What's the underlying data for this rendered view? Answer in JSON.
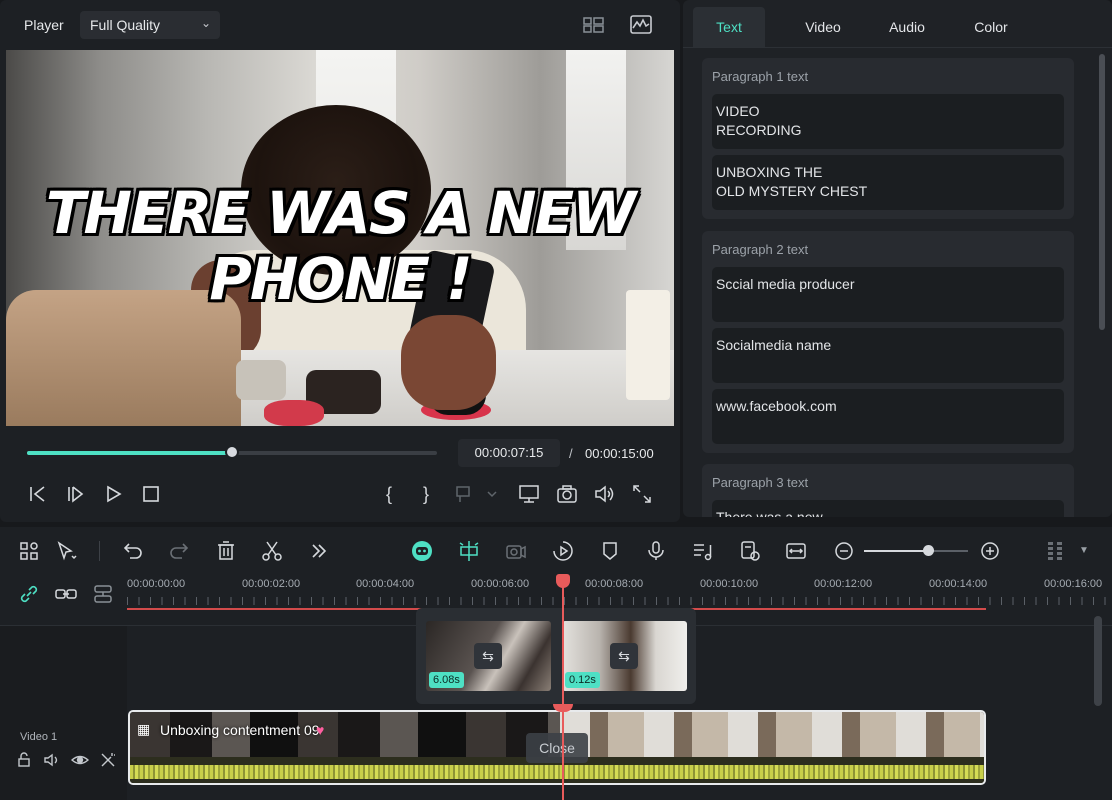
{
  "player": {
    "label": "Player",
    "quality": "Full Quality",
    "overlay_line1": "THERE WAS A NEW",
    "overlay_line2": "PHONE !",
    "current_time": "00:00:07:15",
    "time_separator": "/",
    "total_time": "00:00:15:00",
    "progress_fraction": 0.5,
    "icons": [
      "grid-view-icon",
      "waveform-icon",
      "step-back-icon",
      "step-forward-icon",
      "play-icon",
      "stop-icon",
      "mark-in-icon",
      "mark-out-icon",
      "insert-icon",
      "display-icon",
      "snapshot-icon",
      "volume-icon",
      "fullscreen-icon"
    ]
  },
  "props": {
    "tabs": [
      "Text",
      "Video",
      "Audio",
      "Color"
    ],
    "active_tab": "Text",
    "groups": [
      {
        "title": "Paragraph 1 text",
        "fields": [
          "VIDEO\nRECORDING",
          "UNBOXING THE\nOLD MYSTERY CHEST"
        ]
      },
      {
        "title": "Paragraph 2 text",
        "fields": [
          "Sccial media producer",
          "Socialmedia name",
          "www.facebook.com"
        ]
      },
      {
        "title": "Paragraph 3 text",
        "fields": [
          "There was a new"
        ]
      }
    ]
  },
  "timeline": {
    "toolbar_icons": [
      "layout-icon",
      "select-icon",
      "undo-icon",
      "redo-icon",
      "delete-icon",
      "cut-icon",
      "more-icon",
      "ai-mate-icon",
      "auto-split-icon",
      "ai-camera-icon",
      "speed-icon",
      "marker-icon",
      "mic-icon",
      "music-beat-icon",
      "render-preview-icon",
      "fit-icon",
      "zoom-out-icon",
      "zoom-in-icon",
      "grid-dots-icon",
      "dropdown-icon"
    ],
    "zoom_fraction": 0.62,
    "ruler": [
      "00:00:00:00",
      "00:00:02:00",
      "00:00:04:00",
      "00:00:06:00",
      "00:00:08:00",
      "00:00:10:00",
      "00:00:12:00",
      "00:00:14:00",
      "00:00:16:00"
    ],
    "popover": {
      "clips": [
        {
          "duration": "6.08s"
        },
        {
          "duration": "0.12s"
        }
      ]
    },
    "clip_title": "Unboxing contentment 09",
    "close_label": "Close",
    "track": {
      "name": "Video 1"
    }
  },
  "colors": {
    "accent": "#4ee0c4",
    "playhead": "#e85b5b",
    "waveform": "#c8cf4a"
  }
}
